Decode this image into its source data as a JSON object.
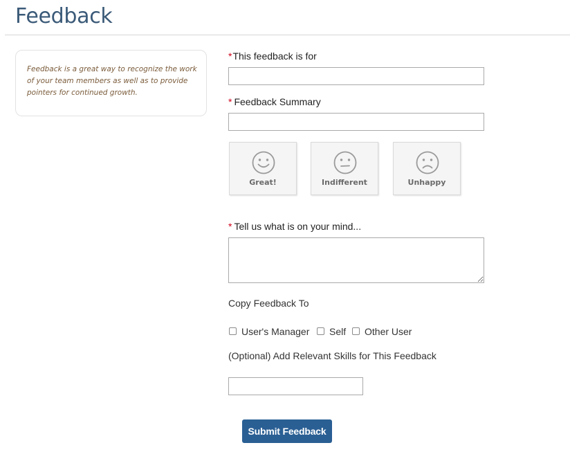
{
  "page": {
    "title": "Feedback"
  },
  "info": {
    "text": "Feedback is a great way to recognize the work of your team members as well as to provide pointers for continued growth."
  },
  "form": {
    "required_marker": "*",
    "feedback_for_label": "This feedback is for",
    "feedback_for_value": "",
    "summary_label": "Feedback Summary",
    "summary_value": "",
    "moods": [
      {
        "label": "Great!",
        "icon": "smile-face-icon"
      },
      {
        "label": "Indifferent",
        "icon": "neutral-face-icon"
      },
      {
        "label": "Unhappy",
        "icon": "sad-face-icon"
      }
    ],
    "mind_label": "Tell us what is on your mind...",
    "mind_value": "",
    "copy_label": "Copy Feedback To",
    "copy_options": [
      {
        "label": "User's Manager",
        "checked": false
      },
      {
        "label": "Self",
        "checked": false
      },
      {
        "label": "Other User",
        "checked": false
      }
    ],
    "skills_label": "(Optional) Add Relevant Skills for This Feedback",
    "skills_value": "",
    "submit_label": "Submit Feedback"
  },
  "colors": {
    "title": "#3b5a78",
    "required": "#d0021b",
    "submit_bg": "#2a5f94",
    "info_text": "#7a5b3a"
  }
}
